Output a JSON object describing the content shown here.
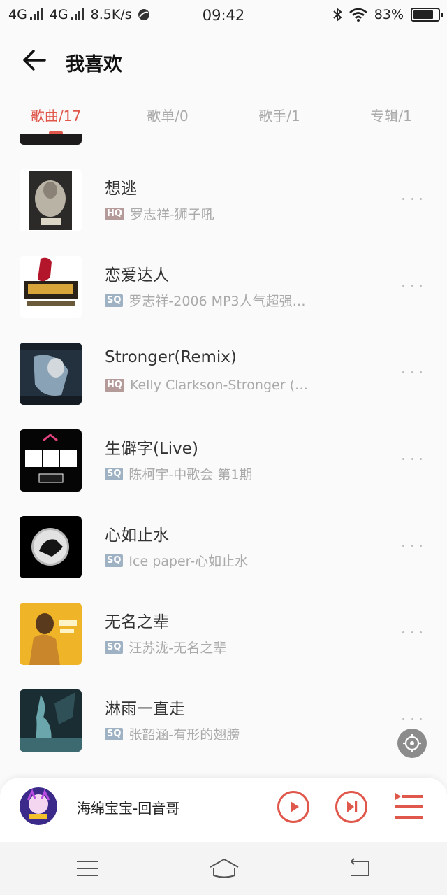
{
  "status": {
    "signal1": "4G",
    "signal2": "4G",
    "speed": "8.5K/s",
    "time": "09:42",
    "battery_text": "83%",
    "battery_level": 0.83
  },
  "header": {
    "back_icon": "arrow-left-icon",
    "title": "我喜欢"
  },
  "tabs": [
    {
      "label": "歌曲/17",
      "active": true
    },
    {
      "label": "歌单/0",
      "active": false
    },
    {
      "label": "歌手/1",
      "active": false
    },
    {
      "label": "专辑/1",
      "active": false
    }
  ],
  "songs": [
    {
      "title": "想逃",
      "quality": "HQ",
      "meta": "罗志祥-狮子吼"
    },
    {
      "title": "恋爱达人",
      "quality": "SQ",
      "meta": "罗志祥-2006 MP3人气超强…"
    },
    {
      "title": "Stronger(Remix)",
      "quality": "HQ",
      "meta": "Kelly Clarkson-Stronger (…"
    },
    {
      "title": "生僻字(Live)",
      "quality": "SQ",
      "meta": "陈柯宇-中歌会 第1期"
    },
    {
      "title": "心如止水",
      "quality": "SQ",
      "meta": "Ice paper-心如止水"
    },
    {
      "title": "无名之辈",
      "quality": "SQ",
      "meta": "汪苏泷-无名之辈"
    },
    {
      "title": "淋雨一直走",
      "quality": "SQ",
      "meta": "张韶涵-有形的翅膀"
    }
  ],
  "player": {
    "now_playing": "海绵宝宝-回音哥",
    "icons": [
      "play-icon",
      "next-icon",
      "playlist-icon"
    ]
  },
  "colors": {
    "accent": "#e0584b",
    "hq_badge": "#b59a9a",
    "sq_badge": "#9fb2c4"
  }
}
